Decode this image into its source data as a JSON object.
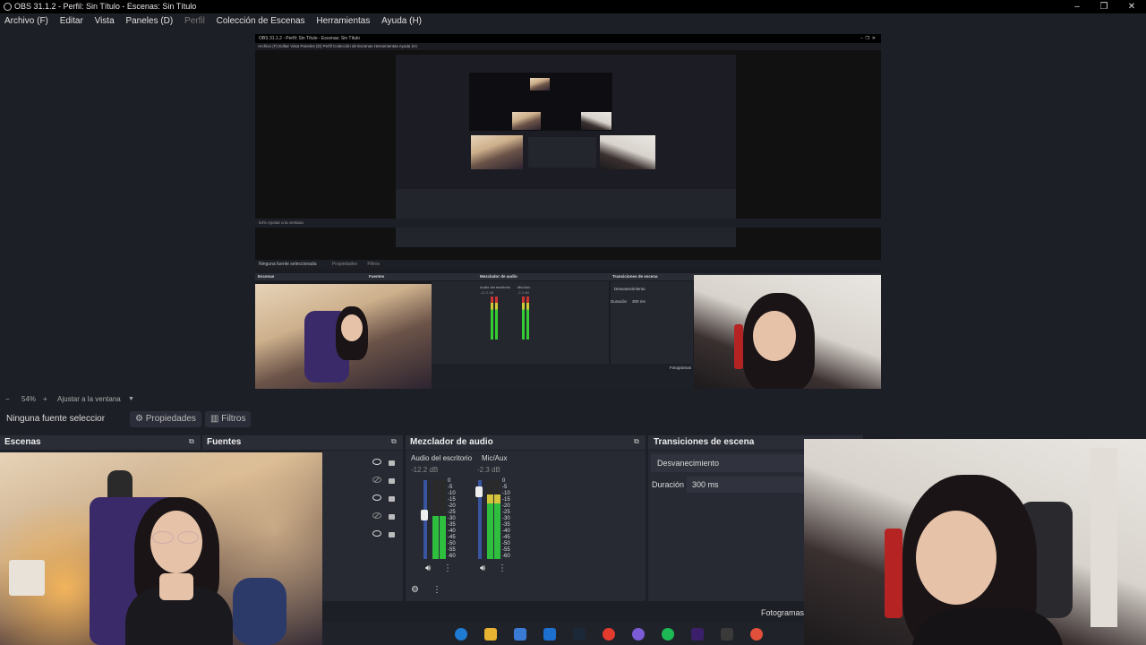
{
  "window": {
    "title": "OBS 31.1.2 - Perfil: Sin Título - Escenas: Sin Título",
    "minimize": "–",
    "restore": "❐",
    "close": "✕"
  },
  "menu": [
    "Archivo (F)",
    "Editar",
    "Vista",
    "Paneles (D)",
    "Perfil",
    "Colección de Escenas",
    "Herramientas",
    "Ayuda (H)"
  ],
  "preview": {
    "nested_title": "OBS 31.1.2 - Perfil: Sin Título - Escenas: Sin Título",
    "nested_menu": "Archivo (F)   Editar   Vista   Paneles (D)   Perfil   Colección de Escenas   Herramientas   Ayuda (H)",
    "nested_zoom": "54%     Ajustar a la ventana",
    "nested_no_source": "Ninguna fuente seleccionada",
    "nested_props": "Propiedades",
    "nested_filters": "Filtros",
    "nested_scenes": "Escenas",
    "nested_sources": "Fuentes",
    "nested_mixer": "Mezclador de audio",
    "nested_transitions": "Transiciones de escena",
    "nested_desktop_audio": "Audio del escritorio",
    "nested_mic": "Mic/Aux",
    "nested_db1": "-12.2 dB",
    "nested_db2": "-2.3 dB",
    "nested_fade": "Desvanecimiento",
    "nested_duration": "Duración",
    "nested_ms": "300 ms",
    "nested_frames": "Fotogramas"
  },
  "zoom": {
    "minus": "−",
    "value": "54%",
    "plus": "+",
    "fit": "Ajustar a la ventana",
    "arrow": "▼"
  },
  "source_toolbar": {
    "no_source": "Ninguna fuente seleccionada",
    "properties": "Propiedades",
    "filters": "Filtros"
  },
  "docks": {
    "scenes": "Escenas",
    "sources": "Fuentes",
    "mixer": "Mezclador de audio",
    "transitions": "Transiciones de escena"
  },
  "mixer": {
    "channels": [
      {
        "name": "Audio del escritorio",
        "db": "-12.2 dB",
        "level": 0.55,
        "volume": 0.62
      },
      {
        "name": "Mic/Aux",
        "db": "-2.3 dB",
        "level": 0.82,
        "volume": 0.92
      }
    ],
    "scale": [
      "0",
      "-5",
      "-10",
      "-15",
      "-20",
      "-25",
      "-30",
      "-35",
      "-40",
      "-45",
      "-50",
      "-55",
      "-60"
    ]
  },
  "transitions": {
    "selected": "Desvanecimiento",
    "duration_label": "Duración",
    "duration_value": "300 ms"
  },
  "status": {
    "frames": "Fotogramas"
  },
  "sources": {
    "rows": [
      {
        "visible": true,
        "locked": true
      },
      {
        "visible": false,
        "locked": true
      },
      {
        "visible": true,
        "locked": true
      },
      {
        "visible": false,
        "locked": true
      },
      {
        "visible": true,
        "locked": true
      }
    ]
  },
  "taskbar": {
    "icons": [
      "edge-icon",
      "file-explorer-icon",
      "store-icon",
      "outlook-icon",
      "steam-icon",
      "chrome-icon",
      "discord-icon",
      "spotify-icon",
      "premiere-icon",
      "obs-icon",
      "davinci-icon"
    ],
    "colors": [
      "#1f7ad1",
      "#e8b331",
      "#3a7bd5",
      "#1d6fd0",
      "#1b2838",
      "#e33b2e",
      "#7b5cd6",
      "#1db954",
      "#3b1f6b",
      "#3a3a3a",
      "#e0503a"
    ]
  }
}
